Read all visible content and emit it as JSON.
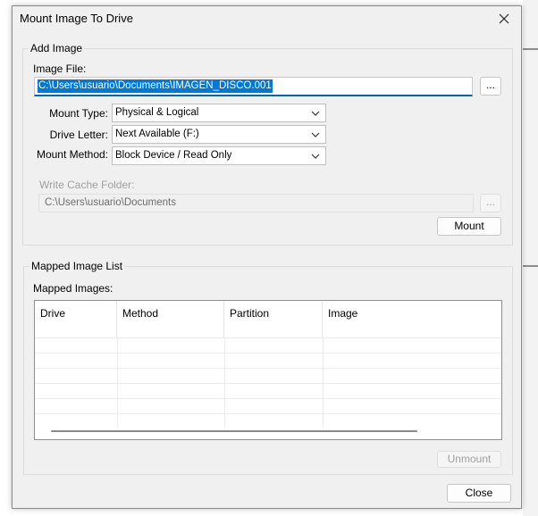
{
  "window": {
    "title": "Mount Image To Drive"
  },
  "add_image": {
    "legend": "Add Image",
    "image_file_label": "Image File:",
    "image_file_value": "C:\\Users\\usuario\\Documents\\IMAGEN_DISCO.001",
    "browse_label": "...",
    "mount_type_label": "Mount Type:",
    "mount_type_value": "Physical & Logical",
    "drive_letter_label": "Drive Letter:",
    "drive_letter_value": "Next Available (F:)",
    "mount_method_label": "Mount Method:",
    "mount_method_value": "Block Device / Read Only",
    "write_cache_label": "Write Cache Folder:",
    "write_cache_value": "C:\\Users\\usuario\\Documents",
    "write_cache_browse_label": "...",
    "mount_button": "Mount"
  },
  "mapped": {
    "legend": "Mapped Image List",
    "list_label": "Mapped Images:",
    "columns": [
      "Drive",
      "Method",
      "Partition",
      "Image"
    ],
    "unmount_button": "Unmount"
  },
  "footer": {
    "close_button": "Close"
  },
  "colors": {
    "accent": "#0078d7",
    "dialog_bg": "#f0f0f0"
  }
}
